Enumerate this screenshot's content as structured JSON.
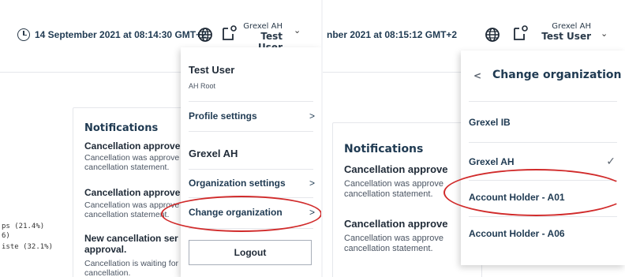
{
  "left": {
    "timestamp": "14 September 2021 at 08:14:30 GMT+2",
    "account": {
      "org": "Grexel AH",
      "user": "Test User"
    },
    "chevron": "⌄",
    "notifications": {
      "title": "Notifications",
      "items": [
        {
          "head": "Cancellation approve",
          "body1": "Cancellation was approve",
          "body2": "cancellation statement."
        },
        {
          "head": "Cancellation approve",
          "body1": "Cancellation was approve",
          "body2": "cancellation statement."
        },
        {
          "head": "New cancellation ser",
          "head2": "approval.",
          "body1": "Cancellation is waiting for",
          "body2": "cancellation."
        }
      ]
    },
    "legend": [
      "ps (21.4%)",
      "6)",
      "iste (32.1%)"
    ],
    "menu": {
      "user_name": "Test User",
      "user_role": "AH Root",
      "profile_settings": "Profile settings",
      "org_name": "Grexel AH",
      "organization_settings": "Organization settings",
      "change_organization": "Change organization",
      "logout": "Logout",
      "arrow": ">"
    }
  },
  "right": {
    "timestamp": "nber 2021 at 08:15:12 GMT+2",
    "account": {
      "org": "Grexel AH",
      "user": "Test User"
    },
    "chevron": "⌄",
    "notifications": {
      "title": "Notifications",
      "items": [
        {
          "head": "Cancellation approve",
          "body1": "Cancellation was approve",
          "body2": "cancellation statement."
        },
        {
          "head": "Cancellation approve",
          "body1": "Cancellation was approve",
          "body2": "cancellation statement."
        }
      ]
    },
    "menu": {
      "back_arrow": "<",
      "header": "Change organization",
      "orgs": [
        "Grexel IB",
        "Grexel AH",
        "Account Holder - A01",
        "Account Holder - A06"
      ],
      "check": "✓"
    }
  },
  "colors": {
    "accent": "#1f3a52",
    "annotation": "#d12b2b"
  }
}
